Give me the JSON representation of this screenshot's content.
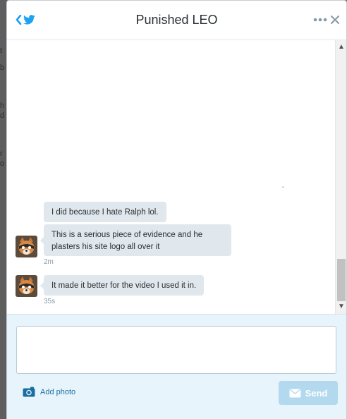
{
  "header": {
    "title": "Punished LEO"
  },
  "messages": [
    {
      "text": "I did because I hate Ralph lol."
    },
    {
      "text": "This is a serious piece of evidence and he plasters his site logo all over it",
      "time": "2m"
    },
    {
      "text": "It made it better for the video I used it in.",
      "time": "35s"
    }
  ],
  "composer": {
    "input_value": "",
    "add_photo_label": "Add photo",
    "send_label": "Send"
  },
  "colors": {
    "accent": "#1da1f2",
    "bubble": "#e1e8ed",
    "send_disabled": "#b3d9ee",
    "composer_bg": "#e8f4fb"
  },
  "icons": {
    "back": "chevron-left-icon",
    "bird": "twitter-bird-icon",
    "more": "more-dots-icon",
    "close": "close-icon",
    "camera": "camera-icon",
    "send": "envelope-icon"
  }
}
